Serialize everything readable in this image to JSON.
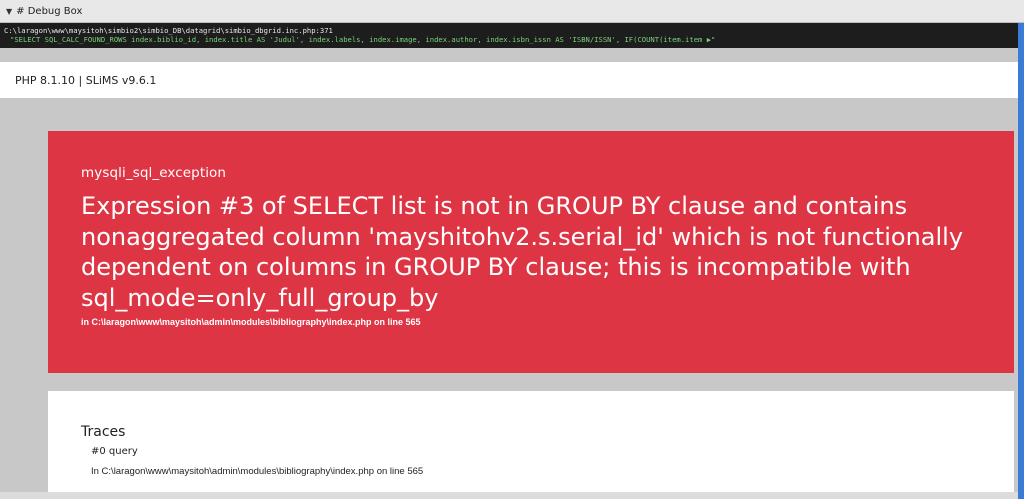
{
  "debug": {
    "title": "# Debug Box",
    "toggle_glyph": "▼",
    "path": "C:\\laragon\\www\\maysitoh\\simbio2\\simbio_DB\\datagrid\\simbio_dbgrid.inc.php:371",
    "sql": "\"SELECT SQL_CALC_FOUND_ROWS  index.biblio_id, index.title AS 'Judul', index.labels, index.image, index.author, index.isbn_issn AS 'ISBN/ISSN', IF(COUNT(item.item",
    "more_glyph": "▶\""
  },
  "version": {
    "text": "PHP 8.1.10 | SLiMS v9.6.1"
  },
  "error": {
    "type": "mysqli_sql_exception",
    "message": "Expression #3 of SELECT list is not in GROUP BY clause and contains nonaggregated column 'mayshitohv2.s.serial_id' which is not functionally dependent on columns in GROUP BY clause; this is incompatible with sql_mode=only_full_group_by",
    "location_prefix": "in C:\\laragon\\www\\maysitoh\\admin\\modules\\bibliography\\index.php",
    "location_suffix": "on line 565"
  },
  "traces": {
    "title": "Traces",
    "items": [
      {
        "name": "#0 query",
        "location_prefix": "In C:\\laragon\\www\\maysitoh\\admin\\modules\\bibliography\\index.php",
        "location_suffix": "on line 565"
      }
    ]
  },
  "colors": {
    "error_bg": "#de3545",
    "debug_bg": "#1d1d1d",
    "sql_text": "#7ad27a",
    "page_bg": "#c8c8c8",
    "accent_strip": "#3a7bd5"
  }
}
